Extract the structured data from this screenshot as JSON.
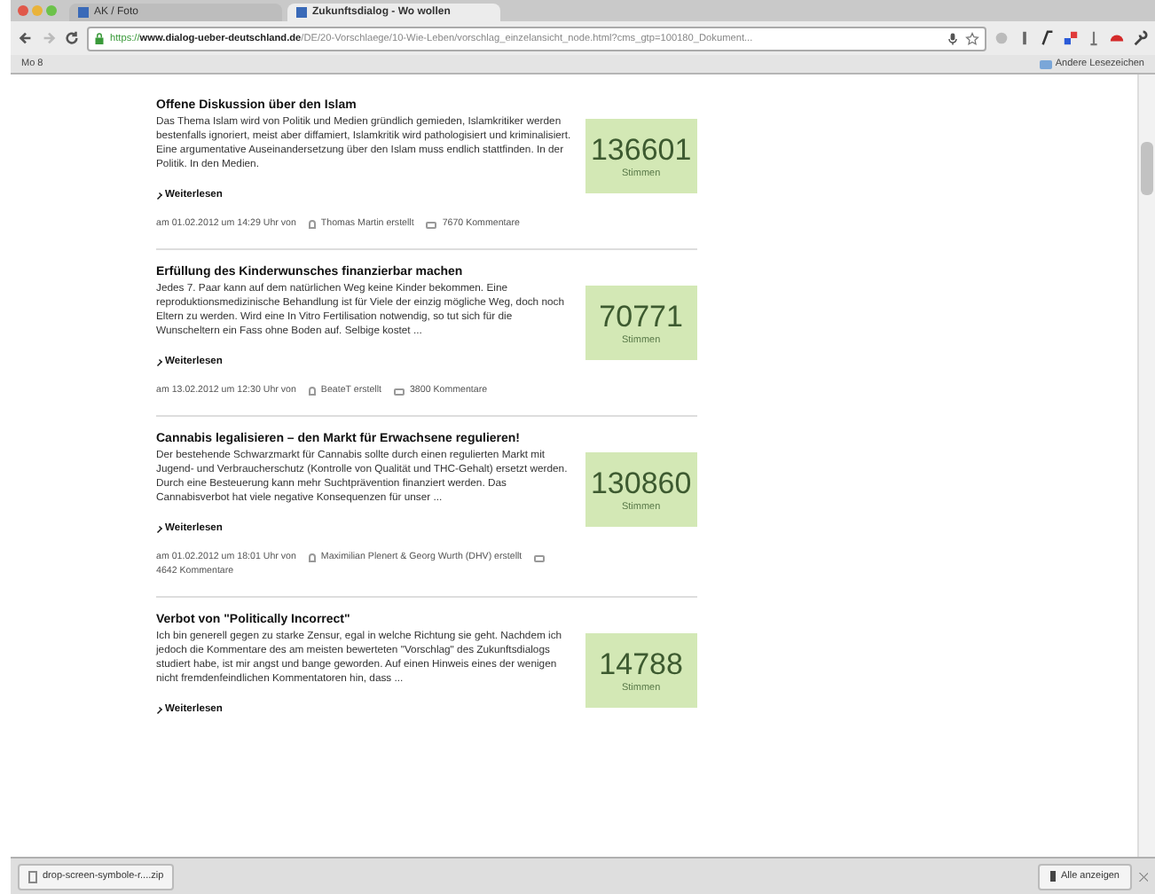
{
  "browser": {
    "tabs": [
      {
        "label": "AK / Foto",
        "selected": false
      },
      {
        "label": "Zukunftsdialog - Wo wollen",
        "selected": true
      }
    ],
    "url": {
      "scheme": "https://",
      "host": "www.dialog-ueber-deutschland.de",
      "path": "/DE/20-Vorschlaege/10-Wie-Leben/vorschlag_einzelansicht_node.html?cms_gtp=100180_Dokument..."
    },
    "bookmarks": [
      {
        "label": "Mo 8"
      }
    ],
    "other_bookmarks": "Andere Lesezeichen"
  },
  "proposals": [
    {
      "title": "Offene Diskussion über den Islam",
      "body": "Das Thema Islam wird von Politik und Medien gründlich gemieden, Islamkritiker werden bestenfalls ignoriert, meist aber diffamiert, Islamkritik wird pathologisiert und kriminalisiert. Eine argumentative Auseinandersetzung über den Islam muss endlich stattfinden. In der Politik. In den Medien.",
      "read_more": "Weiterlesen",
      "date": "am 01.02.2012 um 14:29 Uhr von",
      "author": "Thomas Martin erstellt",
      "comments": "7670 Kommentare",
      "votes": "136601",
      "votes_label": "Stimmen"
    },
    {
      "title": "Erfüllung des Kinderwunsches finanzierbar machen",
      "body": "Jedes 7. Paar kann auf dem natürlichen Weg keine Kinder bekommen. Eine reproduktionsmedizinische Behandlung ist für Viele der einzig mögliche Weg, doch noch Eltern zu werden. Wird eine In Vitro Fertilisation notwendig, so tut sich für die Wunscheltern ein Fass ohne Boden auf. Selbige kostet ...",
      "read_more": "Weiterlesen",
      "date": "am 13.02.2012 um 12:30 Uhr von",
      "author": "BeateT erstellt",
      "comments": "3800 Kommentare",
      "votes": "70771",
      "votes_label": "Stimmen"
    },
    {
      "title": "Cannabis legalisieren – den Markt für Erwachsene regulieren!",
      "body": "Der bestehende Schwarzmarkt für Cannabis sollte durch einen regulierten Markt mit Jugend- und Verbraucherschutz (Kontrolle von Qualität und THC-Gehalt) ersetzt werden. Durch eine Besteuerung kann mehr Suchtprävention finanziert werden. Das Cannabisverbot hat viele negative Konsequenzen für unser ...",
      "read_more": "Weiterlesen",
      "date": "am 01.02.2012 um 18:01 Uhr von",
      "author": "Maximilian Plenert & Georg Wurth (DHV) erstellt",
      "comments": "4642 Kommentare",
      "votes": "130860",
      "votes_label": "Stimmen"
    },
    {
      "title": "Verbot von \"Politically Incorrect\"",
      "body": "Ich bin generell gegen zu starke Zensur, egal in welche Richtung sie geht. Nachdem ich jedoch die Kommentare des am meisten bewerteten \"Vorschlag\" des Zukunftsdialogs studiert habe, ist mir angst und bange geworden. Auf einen Hinweis eines der wenigen nicht fremdenfeindlichen Kommentatoren hin, dass ...",
      "read_more": "Weiterlesen",
      "votes": "14788",
      "votes_label": "Stimmen"
    }
  ],
  "downloads": {
    "file": "drop-screen-symbole-r....zip",
    "show_all": "Alle anzeigen"
  }
}
